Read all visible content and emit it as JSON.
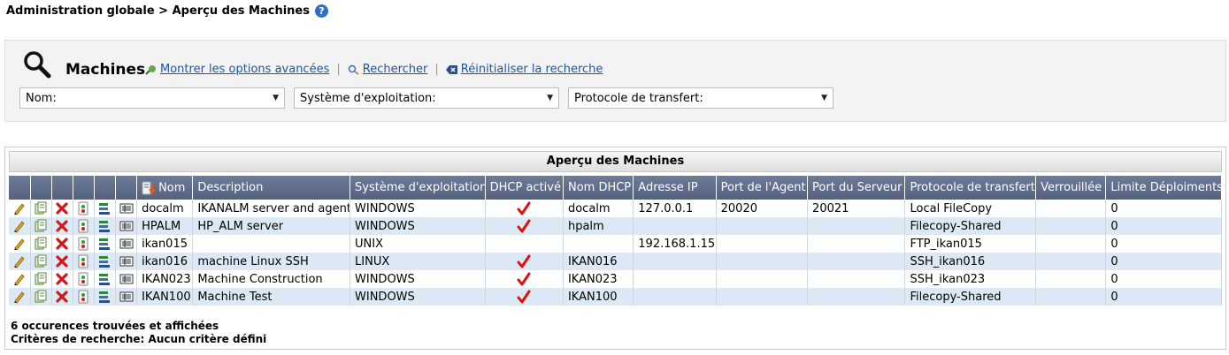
{
  "breadcrumb": "Administration globale > Aperçu des Machines",
  "help_glyph": "?",
  "search": {
    "title": "Machines",
    "links": {
      "advanced": "Montrer les options avancées",
      "search": "Rechercher",
      "reset": "Réinitialiser la recherche"
    },
    "filters": {
      "name": "Nom:",
      "os": "Système d'exploitation:",
      "protocol": "Protocole de transfert:"
    }
  },
  "grid": {
    "title": "Aperçu des Machines",
    "columns": {
      "name": "Nom",
      "description": "Description",
      "os": "Système d'exploitation",
      "dhcp": "DHCP activé",
      "dhcp_name": "Nom DHCP",
      "ip": "Adresse IP",
      "agent_port": "Port de l'Agent",
      "server_port": "Port du Serveur",
      "protocol": "Protocole de transfert",
      "locked": "Verrouillée",
      "deploy_limit": "Limite Déploiments"
    },
    "rows": [
      {
        "name": "docalm",
        "description": "IKANALM server and agent",
        "os": "WINDOWS",
        "dhcp": true,
        "dhcp_name": "docalm",
        "ip": "127.0.0.1",
        "agent_port": "20020",
        "server_port": "20021",
        "protocol": "Local FileCopy",
        "locked": "",
        "limit": "0"
      },
      {
        "name": "HPALM",
        "description": "HP_ALM server",
        "os": "WINDOWS",
        "dhcp": true,
        "dhcp_name": "hpalm",
        "ip": "",
        "agent_port": "",
        "server_port": "",
        "protocol": "Filecopy-Shared",
        "locked": "",
        "limit": "0"
      },
      {
        "name": "ikan015",
        "description": "",
        "os": "UNIX",
        "dhcp": false,
        "dhcp_name": "",
        "ip": "192.168.1.15",
        "agent_port": "",
        "server_port": "",
        "protocol": "FTP_ikan015",
        "locked": "",
        "limit": "0"
      },
      {
        "name": "ikan016",
        "description": "machine Linux SSH",
        "os": "LINUX",
        "dhcp": true,
        "dhcp_name": "IKAN016",
        "ip": "",
        "agent_port": "",
        "server_port": "",
        "protocol": "SSH_ikan016",
        "locked": "",
        "limit": "0"
      },
      {
        "name": "IKAN023",
        "description": "Machine Construction",
        "os": "WINDOWS",
        "dhcp": true,
        "dhcp_name": "IKAN023",
        "ip": "",
        "agent_port": "",
        "server_port": "",
        "protocol": "SSH_ikan023",
        "locked": "",
        "limit": "0"
      },
      {
        "name": "IKAN100",
        "description": "Machine Test",
        "os": "WINDOWS",
        "dhcp": true,
        "dhcp_name": "IKAN100",
        "ip": "",
        "agent_port": "",
        "server_port": "",
        "protocol": "Filecopy-Shared",
        "locked": "",
        "limit": "0"
      }
    ]
  },
  "footer": {
    "count": "6 occurences trouvées et affichées",
    "criteria": "Critères de recherche: Aucun critère défini"
  },
  "colors": {
    "header": "#5f6c8b",
    "alt_row": "#dde8f5",
    "link": "#1a55a8",
    "check": "#e01010"
  }
}
